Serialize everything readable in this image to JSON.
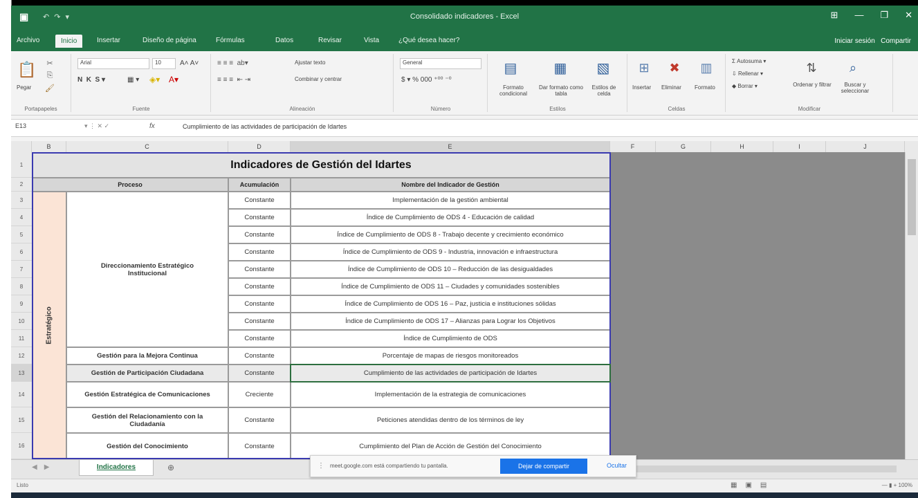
{
  "window": {
    "title": "Consolidado indicadores - Excel",
    "controls": [
      "⊞",
      "—",
      "❐",
      "✕"
    ]
  },
  "ribbon_tabs": [
    "Archivo",
    "Inicio",
    "Insertar",
    "Diseño de página",
    "Fórmulas",
    "Datos",
    "Revisar",
    "Vista",
    "¿Qué desea hacer?"
  ],
  "ribbon_tab_active": "Inicio",
  "account": {
    "signin": "Iniciar sesión",
    "share": "Compartir"
  },
  "ribbon": {
    "clipboard": {
      "paste": "Pegar",
      "group": "Portapapeles"
    },
    "font": {
      "name": "Arial",
      "size": "10",
      "group": "Fuente"
    },
    "alignment": {
      "wrap": "Ajustar texto",
      "merge": "Combinar y centrar",
      "group": "Alineación"
    },
    "number": {
      "format": "General",
      "group": "Número"
    },
    "styles": {
      "conditional": "Formato condicional",
      "table": "Dar formato como tabla",
      "cell": "Estilos de celda",
      "group": "Estilos"
    },
    "cells": {
      "insert": "Insertar",
      "delete": "Eliminar",
      "format": "Formato",
      "group": "Celdas"
    },
    "editing": {
      "autosum": "Autosuma",
      "fill": "Rellenar",
      "clear": "Borrar",
      "sort": "Ordenar y filtrar",
      "find": "Buscar y seleccionar",
      "group": "Modificar"
    }
  },
  "formula_bar": {
    "name_box": "E13",
    "fx": "fx",
    "content": "Cumplimiento de las actividades de participación de Idartes"
  },
  "columns": [
    "B",
    "C",
    "D",
    "E",
    "F",
    "G",
    "H",
    "I",
    "J"
  ],
  "rows": [
    "1",
    "2",
    "3",
    "4",
    "5",
    "6",
    "7",
    "8",
    "9",
    "10",
    "11",
    "12",
    "13",
    "14",
    "15",
    "16"
  ],
  "table": {
    "title": "Indicadores de Gestión del Idartes",
    "headers": {
      "proceso": "Proceso",
      "acumulacion": "Acumulación",
      "nombre": "Nombre del Indicador de Gestión"
    },
    "category": "Estratégico",
    "rows": [
      {
        "proceso": "Direccionamiento Estratégico Institucional",
        "acumulacion": "Constante",
        "nombre": "Implementación de la gestión ambiental"
      },
      {
        "proceso": "",
        "acumulacion": "Constante",
        "nombre": "Índice de Cumplimiento de ODS 4 - Educación de calidad"
      },
      {
        "proceso": "",
        "acumulacion": "Constante",
        "nombre": "Índice de Cumplimiento de ODS 8 - Trabajo decente y crecimiento económico"
      },
      {
        "proceso": "",
        "acumulacion": "Constante",
        "nombre": "Índice de Cumplimiento de ODS 9 - Industria, innovación e infraestructura"
      },
      {
        "proceso": "",
        "acumulacion": "Constante",
        "nombre": "Índice de Cumplimiento de ODS 10 – Reducción de las desigualdades"
      },
      {
        "proceso": "",
        "acumulacion": "Constante",
        "nombre": "Índice de Cumplimiento de ODS 11 – Ciudades y comunidades sostenibles"
      },
      {
        "proceso": "",
        "acumulacion": "Constante",
        "nombre": "Índice de Cumplimiento de ODS 16 – Paz, justicia e instituciones sólidas"
      },
      {
        "proceso": "",
        "acumulacion": "Constante",
        "nombre": "Índice de Cumplimiento de ODS 17 – Alianzas para Lograr los Objetivos"
      },
      {
        "proceso": "",
        "acumulacion": "Constante",
        "nombre": "Índice de Cumplimiento de ODS"
      },
      {
        "proceso": "Gestión para la Mejora Continua",
        "acumulacion": "Constante",
        "nombre": "Porcentaje de mapas de riesgos monitoreados"
      },
      {
        "proceso": "Gestión de Participación Ciudadana",
        "acumulacion": "Constante",
        "nombre": "Cumplimiento de las actividades de participación de Idartes"
      },
      {
        "proceso": "Gestión Estratégica de Comunicaciones",
        "acumulacion": "Creciente",
        "nombre": "Implementación de la estrategia de comunicaciones"
      },
      {
        "proceso": "Gestión del Relacionamiento con la Ciudadanía",
        "acumulacion": "Constante",
        "nombre": "Peticiones atendidas dentro de los términos de ley"
      },
      {
        "proceso": "Gestión del Conocimiento",
        "acumulacion": "Constante",
        "nombre": "Cumplimiento del Plan de Acción de Gestión del Conocimiento"
      }
    ]
  },
  "sheet_tab": "Indicadores",
  "share_notice": {
    "message": "meet.google.com está compartiendo tu pantalla.",
    "stop": "Dejar de compartir",
    "hide": "Ocultar"
  },
  "status": {
    "ready": "Listo",
    "zoom": "100%"
  }
}
